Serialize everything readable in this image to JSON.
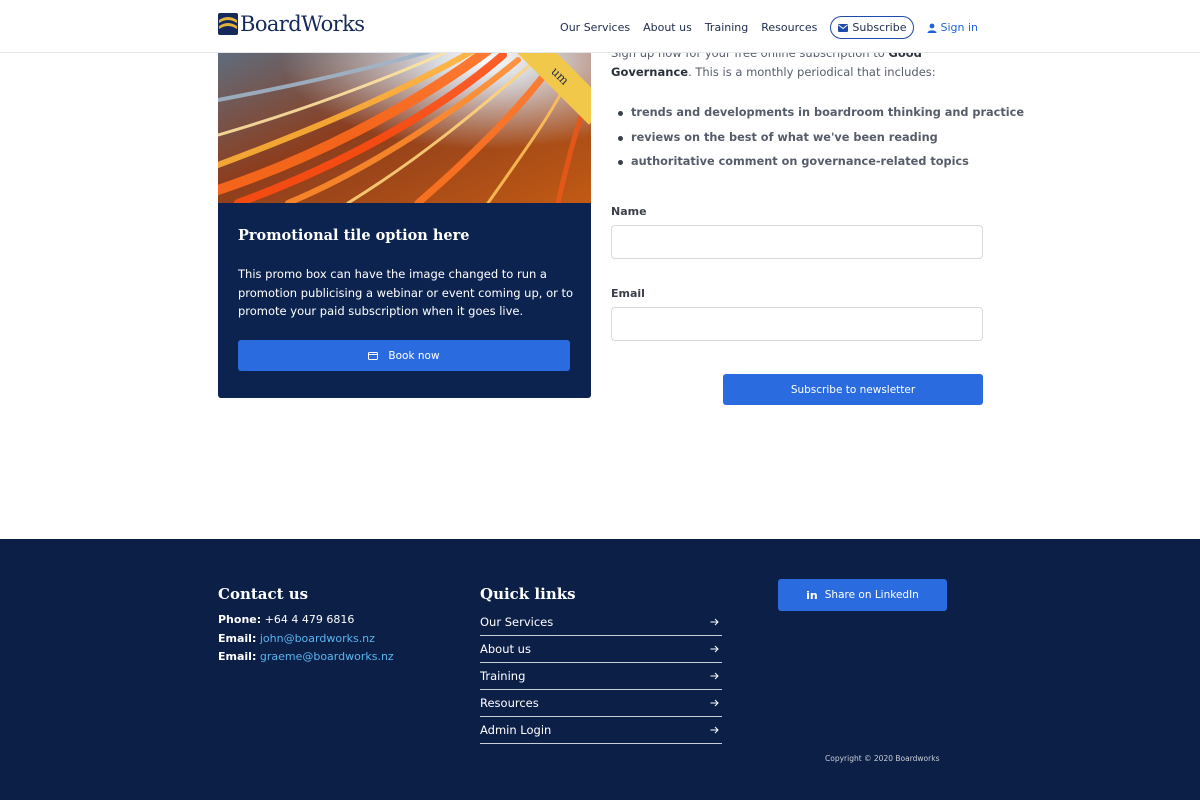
{
  "header": {
    "brand": "BoardWorks",
    "nav": [
      {
        "id": "our-services",
        "label": "Our Services"
      },
      {
        "id": "about-us",
        "label": "About us"
      },
      {
        "id": "training",
        "label": "Training"
      },
      {
        "id": "resources",
        "label": "Resources"
      }
    ],
    "subscribe_label": "Subscribe",
    "signin_label": "Sign in"
  },
  "promo": {
    "ribbon_text": "um",
    "title": "Promotional tile option here",
    "text": "This promo box can have the image changed to run a promotion publicising a webinar or event coming up, or to promote your paid subscription when it goes live.",
    "button_label": "Book now"
  },
  "signup": {
    "intro_before": "Sign up now for your free online subscription to ",
    "intro_strong": "Good Governance",
    "intro_after": ". This is a monthly periodical that includes:",
    "bullets": [
      "trends and developments in boardroom thinking and practice",
      "reviews on the best of what we've been reading",
      "authoritative comment on governance-related topics"
    ],
    "name_label": "Name",
    "name_value": "",
    "email_label": "Email",
    "email_value": "",
    "submit_label": "Subscribe to newsletter"
  },
  "footer": {
    "contact_heading": "Contact us",
    "phone_label": "Phone:",
    "phone": "+64 4 479 6816",
    "email1_label": "Email:",
    "email1": "john@boardworks.nz",
    "email2_label": "Email:",
    "email2": "graeme@boardworks.nz",
    "quick_heading": "Quick links",
    "quick_links": [
      "Our Services",
      "About us",
      "Training",
      "Resources",
      "Admin Login"
    ],
    "linkedin_label": "Share on LinkedIn",
    "copyright": "Copyright © 2020 Boardworks"
  },
  "icons": {
    "logo": "boardworks-logo-mark",
    "subscribe": "envelope-icon",
    "signin": "user-icon",
    "book": "ticket-icon",
    "quick_link_arrow": "arrow-right-icon",
    "linkedin": "linkedin-icon"
  },
  "colors": {
    "navy": "#0c234f",
    "footer_navy": "#0c1f47",
    "accent_blue": "#2a6ce0",
    "link_blue": "#5ab4ef",
    "ribbon_yellow": "#f2c84b"
  }
}
